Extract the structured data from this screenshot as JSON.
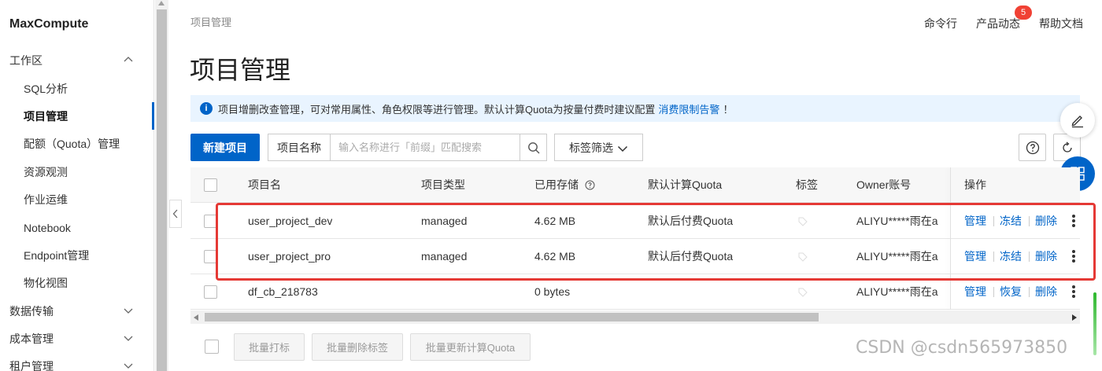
{
  "sidebar": {
    "brand": "MaxCompute",
    "workspace_group": "工作区",
    "items": [
      {
        "label": "SQL分析"
      },
      {
        "label": "项目管理"
      },
      {
        "label": "配额（Quota）管理"
      },
      {
        "label": "资源观测"
      },
      {
        "label": "作业运维"
      },
      {
        "label": "Notebook"
      },
      {
        "label": "Endpoint管理"
      },
      {
        "label": "物化视图"
      }
    ],
    "groups": [
      {
        "label": "数据传输"
      },
      {
        "label": "成本管理"
      },
      {
        "label": "租户管理"
      }
    ]
  },
  "header": {
    "breadcrumb": "项目管理",
    "title": "项目管理",
    "nav": {
      "cli": "命令行",
      "product_news": "产品动态",
      "product_news_badge": "5",
      "help_docs": "帮助文档"
    }
  },
  "notice": {
    "text": "项目增删改查管理，可对常用属性、角色权限等进行管理。默认计算Quota为按量付费时建议配置",
    "link": "消费限制告警",
    "suffix": "！"
  },
  "toolbar": {
    "create_button": "新建项目",
    "search_field_label": "项目名称",
    "search_placeholder": "输入名称进行「前缀」匹配搜索",
    "tag_filter": "标签筛选"
  },
  "table": {
    "columns": {
      "name": "项目名",
      "type": "项目类型",
      "storage": "已用存储",
      "quota": "默认计算Quota",
      "tag": "标签",
      "owner": "Owner账号",
      "ops": "操作"
    },
    "rows": [
      {
        "name": "user_project_dev",
        "type": "managed",
        "storage": "4.62 MB",
        "quota": "默认后付费Quota",
        "owner": "ALIYU*****雨在ali",
        "op1": "管理",
        "op2": "冻结",
        "op3": "删除"
      },
      {
        "name": "user_project_pro",
        "type": "managed",
        "storage": "4.62 MB",
        "quota": "默认后付费Quota",
        "owner": "ALIYU*****雨在ali",
        "op1": "管理",
        "op2": "冻结",
        "op3": "删除"
      },
      {
        "name": "df_cb_218783",
        "type": "",
        "storage": "0 bytes",
        "quota": "",
        "owner": "ALIYU*****雨在ali",
        "op1": "管理",
        "op2": "恢复",
        "op3": "删除"
      }
    ]
  },
  "batch": {
    "tag": "批量打标",
    "remove_tag": "批量删除标签",
    "update_quota": "批量更新计算Quota"
  },
  "watermark": "CSDN @csdn565973850",
  "colors": {
    "primary": "#0064c8",
    "highlight": "#e53935",
    "notice_bg": "#e9f4ff",
    "badge": "#f04134"
  }
}
